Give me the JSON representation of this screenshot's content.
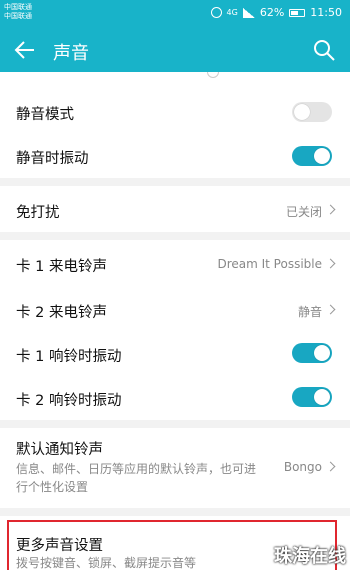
{
  "status": {
    "carrier_1": "中国联通",
    "carrier_2": "中国联通",
    "network": "4G",
    "battery": "62%",
    "battery_level": 0.62,
    "time": "11:50"
  },
  "appbar": {
    "title": "声音",
    "back_icon": "arrow-left-icon",
    "search_icon": "search-icon"
  },
  "settings": {
    "silent_mode": {
      "label": "静音模式",
      "on": false
    },
    "vibrate_silent": {
      "label": "静音时振动",
      "on": true
    },
    "dnd": {
      "label": "免打扰",
      "value": "已关闭"
    },
    "card1_ringtone": {
      "label": "卡 1 来电铃声",
      "value": "Dream It Possible"
    },
    "card2_ringtone": {
      "label": "卡 2 来电铃声",
      "value": "静音"
    },
    "card1_vibrate": {
      "label": "卡 1 响铃时振动",
      "on": true
    },
    "card2_vibrate": {
      "label": "卡 2 响铃时振动",
      "on": true
    },
    "notification": {
      "label": "默认通知铃声",
      "desc": "信息、邮件、日历等应用的默认铃声，也可进行个性化设置",
      "value": "Bongo"
    },
    "more": {
      "label": "更多声音设置",
      "desc": "拨号按键音、锁屏、截屏提示音等"
    }
  },
  "colors": {
    "accent": "#18b3c9",
    "toggle_on": "#18a7c2",
    "highlight": "#e0262f"
  },
  "watermark": "珠海在线"
}
